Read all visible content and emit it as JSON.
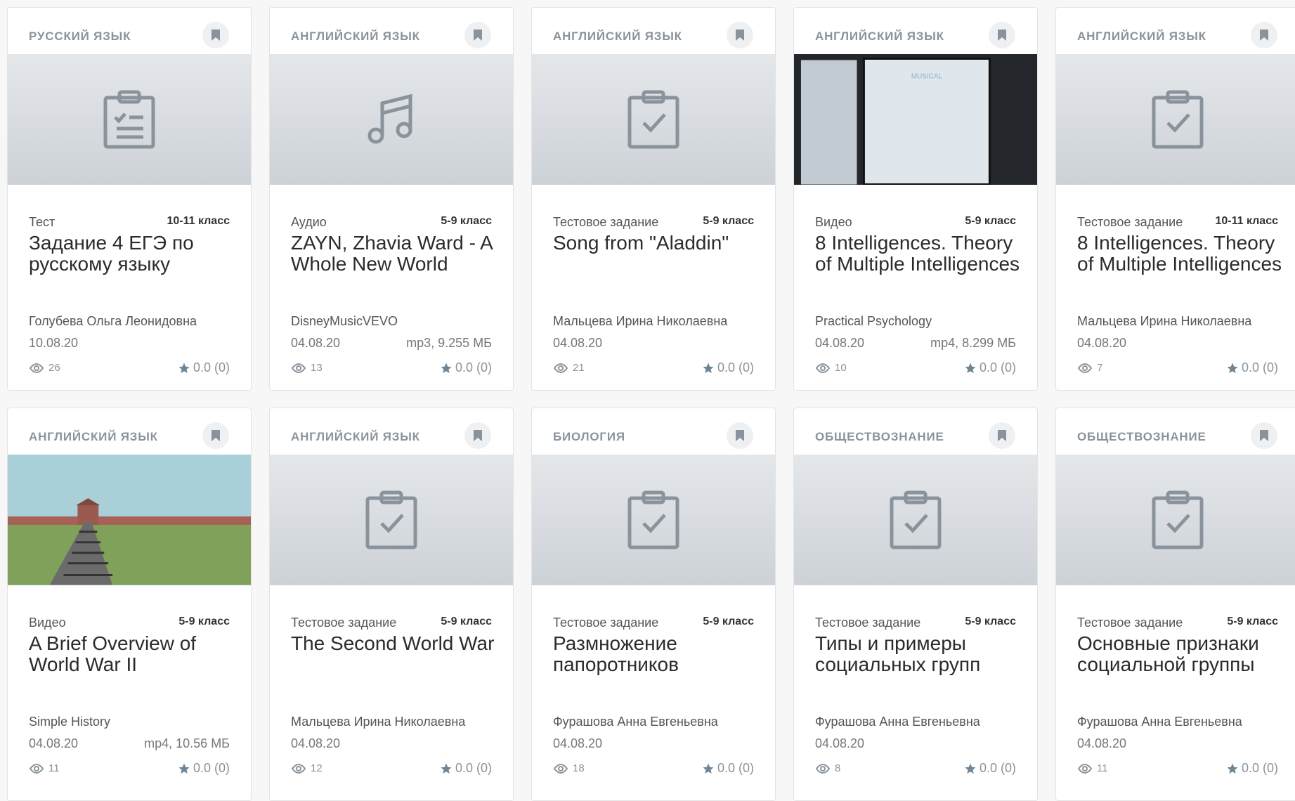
{
  "cards": [
    {
      "subject": "РУССКИЙ ЯЗЫК",
      "type": "Тест",
      "grade": "10-11 класс",
      "title": "Задание 4 ЕГЭ по русскому языку",
      "author": "Голубева Ольга Леонидовна",
      "date": "10.08.20",
      "file": "",
      "views": "26",
      "rating": "0.0 (0)",
      "thumb": "checklist-icon"
    },
    {
      "subject": "АНГЛИЙСКИЙ ЯЗЫК",
      "type": "Аудио",
      "grade": "5-9 класс",
      "title": "ZAYN, Zhavia Ward - A Whole New World",
      "author": "DisneyMusicVEVO",
      "date": "04.08.20",
      "file": "mp3, 9.255 МБ",
      "views": "13",
      "rating": "0.0 (0)",
      "thumb": "music-note-icon"
    },
    {
      "subject": "АНГЛИЙСКИЙ ЯЗЫК",
      "type": "Тестовое задание",
      "grade": "5-9 класс",
      "title": "Song from \"Aladdin\"",
      "author": "Мальцева Ирина Николаевна",
      "date": "04.08.20",
      "file": "",
      "views": "21",
      "rating": "0.0 (0)",
      "thumb": "clipboard-check-icon"
    },
    {
      "subject": "АНГЛИЙСКИЙ ЯЗЫК",
      "type": "Видео",
      "grade": "5-9 класс",
      "title": "8 Intelligences. Theory of Multiple Intelligences",
      "author": "Practical Psychology",
      "date": "04.08.20",
      "file": "mp4, 8.299 МБ",
      "views": "10",
      "rating": "0.0 (0)",
      "thumb": "video-frame",
      "thumb_text": "MUSICAL"
    },
    {
      "subject": "АНГЛИЙСКИЙ ЯЗЫК",
      "type": "Тестовое задание",
      "grade": "10-11 класс",
      "title": "8 Intelligences. Theory of Multiple Intelligences",
      "author": "Мальцева Ирина Николаевна",
      "date": "04.08.20",
      "file": "",
      "views": "7",
      "rating": "0.0 (0)",
      "thumb": "clipboard-check-icon"
    },
    {
      "subject": "АНГЛИЙСКИЙ ЯЗЫК",
      "type": "Видео",
      "grade": "5-9 класс",
      "title": "A Brief Overview of World War II",
      "author": "Simple History",
      "date": "04.08.20",
      "file": "mp4, 10.56 МБ",
      "views": "11",
      "rating": "0.0 (0)",
      "thumb": "video-landscape"
    },
    {
      "subject": "АНГЛИЙСКИЙ ЯЗЫК",
      "type": "Тестовое задание",
      "grade": "5-9 класс",
      "title": "The Second World War",
      "author": "Мальцева Ирина Николаевна",
      "date": "04.08.20",
      "file": "",
      "views": "12",
      "rating": "0.0 (0)",
      "thumb": "clipboard-check-icon"
    },
    {
      "subject": "БИОЛОГИЯ",
      "type": "Тестовое задание",
      "grade": "5-9 класс",
      "title": "Размножение папоротников",
      "author": "Фурашова Анна Евгеньевна",
      "date": "04.08.20",
      "file": "",
      "views": "18",
      "rating": "0.0 (0)",
      "thumb": "clipboard-check-icon"
    },
    {
      "subject": "ОБЩЕСТВОЗНАНИЕ",
      "type": "Тестовое задание",
      "grade": "5-9 класс",
      "title": "Типы и примеры социальных групп",
      "author": "Фурашова Анна Евгеньевна",
      "date": "04.08.20",
      "file": "",
      "views": "8",
      "rating": "0.0 (0)",
      "thumb": "clipboard-check-icon"
    },
    {
      "subject": "ОБЩЕСТВОЗНАНИЕ",
      "type": "Тестовое задание",
      "grade": "5-9 класс",
      "title": "Основные признаки социальной группы",
      "author": "Фурашова Анна Евгеньевна",
      "date": "04.08.20",
      "file": "",
      "views": "11",
      "rating": "0.0 (0)",
      "thumb": "clipboard-check-icon"
    }
  ],
  "colors": {
    "icon": "#8a939b",
    "star": "#6e8596",
    "bookmark_bg": "#eef0f2"
  }
}
